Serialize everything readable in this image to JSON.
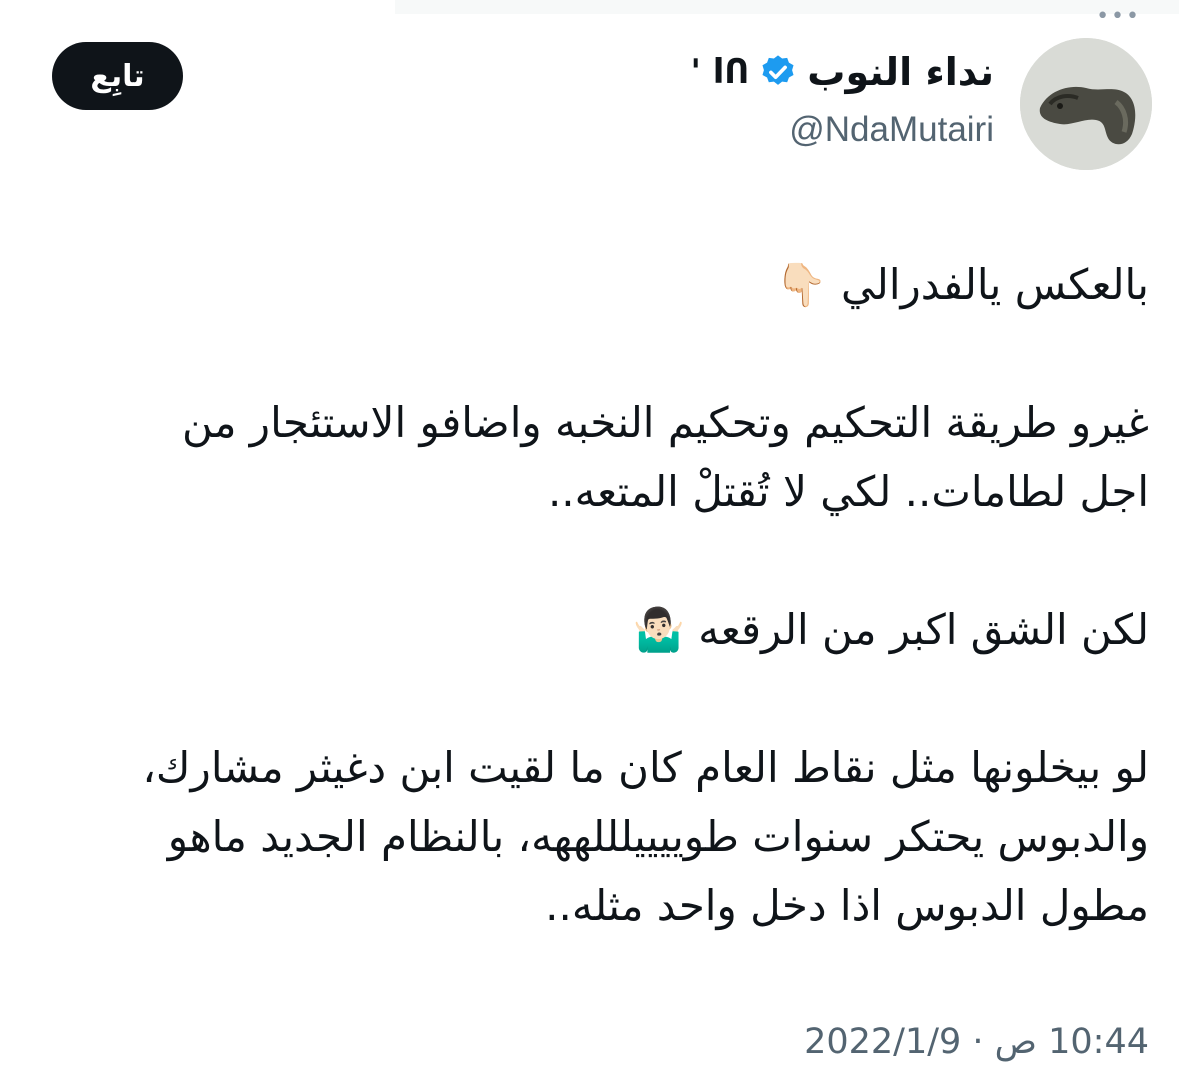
{
  "author": {
    "display_name": "نداء النوب",
    "name_suffix": "' lՈ",
    "handle": "@NdaMutairi"
  },
  "follow_button": {
    "label": "تابِع"
  },
  "tweet": {
    "line1": "بالعكس يالفدرالي 👇🏻",
    "line2": "غيرو طريقة التحكيم وتحكيم النخبه واضافو الاستئجار من",
    "line3": "اجل لطامات.. لكي لا تُقتلْ المتعه..",
    "line4": "لكن الشق اكبر من الرقعه 🤷🏻‍♂️",
    "line5": "لو بيخلونها مثل نقاط العام كان ما لقيت ابن دغيثر مشارك،",
    "line6": "والدبوس يحتكر سنوات طوييييلللههه، بالنظام الجديد ماهو",
    "line7": "مطول الدبوس اذا دخل واحد مثله.."
  },
  "timestamp": "10:44 ص · 2022/1/9",
  "icons": {
    "verified": "verified-badge-icon",
    "more": "more-options-icon"
  },
  "colors": {
    "verified_blue": "#1d9bf0",
    "button_bg": "#0f1419",
    "secondary_text": "#536471"
  }
}
